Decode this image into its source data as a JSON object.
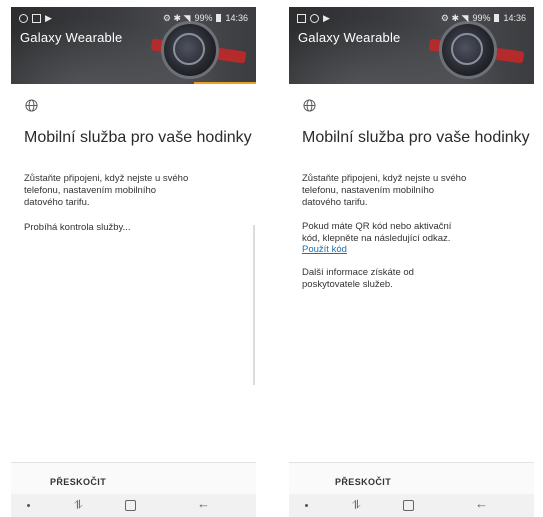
{
  "left_screen": {
    "status_time": "14:36",
    "status_battery": "99%",
    "app_title": "Galaxy Wearable",
    "content_title": "Mobilní služba pro vaše hodinky",
    "intro_text": "Zůstaňte připojeni, když nejste u svého telefonu, nastavením mobilního datového tarifu.",
    "checking_text": "Probíhá kontrola služby...",
    "skip_label": "PŘESKOČIT"
  },
  "right_screen": {
    "status_time": "14:36",
    "status_battery": "99%",
    "app_title": "Galaxy Wearable",
    "content_title": "Mobilní služba pro vaše hodinky",
    "intro_text": "Zůstaňte připojeni, když nejste u svého telefonu, nastavením mobilního datového tarifu.",
    "qr_text": "Pokud máte QR kód nebo aktivační kód, klepněte na následující odkaz.",
    "use_code_link": "Použít kód",
    "provider_text": "Další informace získáte od poskytovatele služeb.",
    "skip_label": "PŘESKOČIT"
  },
  "icons": {
    "globe": "globe-icon",
    "nav_recent": "recent-apps-icon",
    "nav_home": "home-icon",
    "nav_back": "back-arrow-icon"
  },
  "colors": {
    "link": "#1a6fb5",
    "header_accent": "#f0a020"
  }
}
